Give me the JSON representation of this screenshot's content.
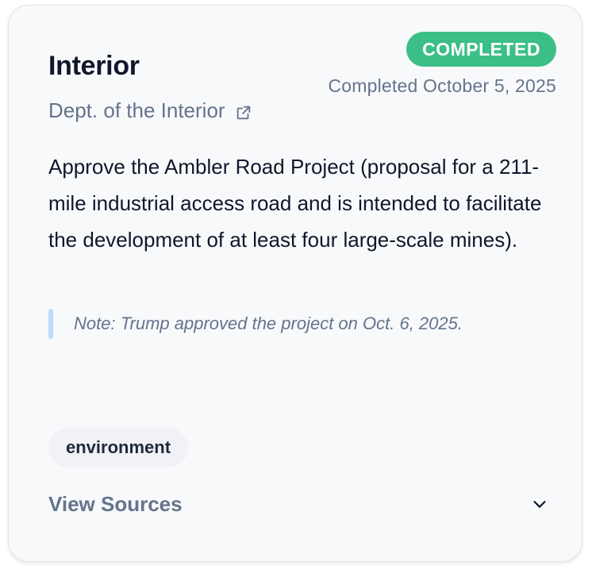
{
  "card": {
    "title": "Interior",
    "status": "COMPLETED",
    "completed_date": "Completed October 5, 2025",
    "agency": "Dept. of the Interior",
    "description": "Approve the Ambler Road Project (proposal for a 211-mile industrial access road and is intended to facilitate the development of at least four large-scale mines).",
    "note": "Note: Trump approved the project on Oct. 6, 2025.",
    "tag": "environment",
    "view_sources_label": "View Sources"
  },
  "icons": {
    "agency_link": "external-link-icon",
    "view_sources": "chevron-down-icon"
  },
  "colors": {
    "status_badge": "#3bbf86",
    "note_bar": "#bfdbfe",
    "muted_text": "#64748b",
    "primary_text": "#0f172a"
  }
}
